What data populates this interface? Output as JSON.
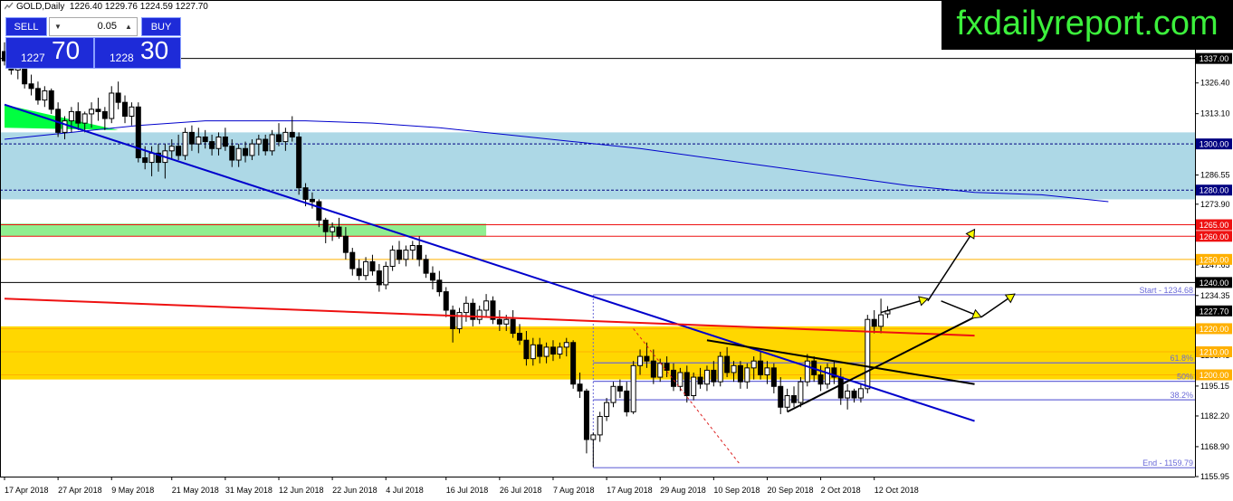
{
  "header": {
    "symbol_label": "GOLD,Daily",
    "ohlc_label": "1226.40 1229.76 1224.59 1227.70"
  },
  "trade_panel": {
    "sell_label": "SELL",
    "buy_label": "BUY",
    "lot_value": "0.05",
    "bid_small": "1227",
    "bid_big": "70",
    "ask_small": "1228",
    "ask_big": "30"
  },
  "brand_text": "fxdailyreport.com",
  "colors": {
    "band_blue": "#add8e6",
    "band_green": "#90ee90",
    "band_gold": "#ffd700",
    "wedge_green": "#00ff40",
    "trend_blue": "#0000cc",
    "trend_red": "#ee1111",
    "fib_line": "#6a6ad8",
    "arrow_fill": "#ffff00"
  },
  "chart_data": {
    "type": "candlestick",
    "y_range": [
      1155.95,
      1340.0
    ],
    "x_index_range": [
      0,
      145
    ],
    "y_tick_labels": [
      "1326.40",
      "1313.10",
      "1286.55",
      "1273.90",
      "1247.65",
      "1234.35",
      "1221.00",
      "1208.45",
      "1195.15",
      "1182.20",
      "1168.90",
      "1155.95"
    ],
    "x_tick_labels": [
      {
        "i": 0,
        "label": "17 Apr 2018"
      },
      {
        "i": 8,
        "label": "27 Apr 2018"
      },
      {
        "i": 16,
        "label": "9 May 2018"
      },
      {
        "i": 25,
        "label": "21 May 2018"
      },
      {
        "i": 33,
        "label": "31 May 2018"
      },
      {
        "i": 41,
        "label": "12 Jun 2018"
      },
      {
        "i": 49,
        "label": "22 Jun 2018"
      },
      {
        "i": 57,
        "label": "4 Jul 2018"
      },
      {
        "i": 66,
        "label": "16 Jul 2018"
      },
      {
        "i": 74,
        "label": "26 Jul 2018"
      },
      {
        "i": 82,
        "label": "7 Aug 2018"
      },
      {
        "i": 90,
        "label": "17 Aug 2018"
      },
      {
        "i": 98,
        "label": "29 Aug 2018"
      },
      {
        "i": 106,
        "label": "10 Sep 2018"
      },
      {
        "i": 114,
        "label": "20 Sep 2018"
      },
      {
        "i": 122,
        "label": "2 Oct 2018"
      },
      {
        "i": 130,
        "label": "12 Oct 2018"
      }
    ],
    "price_labels": [
      {
        "value": 1337.0,
        "text": "1337.00",
        "style": "dark"
      },
      {
        "value": 1300.0,
        "text": "1300.00",
        "style": "navy"
      },
      {
        "value": 1280.0,
        "text": "1280.00",
        "style": "navy"
      },
      {
        "value": 1265.0,
        "text": "1265.00",
        "style": "red"
      },
      {
        "value": 1260.0,
        "text": "1260.00",
        "style": "red"
      },
      {
        "value": 1250.0,
        "text": "1250.00",
        "style": "gold"
      },
      {
        "value": 1240.0,
        "text": "1240.00",
        "style": "dark"
      },
      {
        "value": 1227.7,
        "text": "1227.70",
        "style": "dark"
      },
      {
        "value": 1220.0,
        "text": "1220.00",
        "style": "gold"
      },
      {
        "value": 1210.0,
        "text": "1210.00",
        "style": "gold"
      },
      {
        "value": 1200.0,
        "text": "1200.00",
        "style": "gold"
      }
    ],
    "zones": [
      {
        "name": "resistance-blue",
        "from": 1276,
        "to": 1305,
        "color": "#add8e6"
      },
      {
        "name": "resistance-green",
        "from": 1260,
        "to": 1265.5,
        "color": "#90ee90",
        "x_end_index": 72
      },
      {
        "name": "support-gold",
        "from": 1198,
        "to": 1221,
        "color": "#ffd700"
      }
    ],
    "horizontal_lines": [
      {
        "value": 1337.0,
        "color": "#000000",
        "style": "solid"
      },
      {
        "value": 1300.0,
        "color": "#000080",
        "style": "dashed"
      },
      {
        "value": 1280.0,
        "color": "#000080",
        "style": "dashed"
      },
      {
        "value": 1265.0,
        "color": "#ee1111",
        "style": "solid"
      },
      {
        "value": 1260.0,
        "color": "#ee1111",
        "style": "solid"
      },
      {
        "value": 1250.0,
        "color": "#ffb000",
        "style": "solid"
      },
      {
        "value": 1240.0,
        "color": "#000000",
        "style": "solid"
      },
      {
        "value": 1220.0,
        "color": "#ffb000",
        "style": "solid"
      },
      {
        "value": 1210.0,
        "color": "#ffb000",
        "style": "solid"
      },
      {
        "value": 1200.0,
        "color": "#ffb000",
        "style": "solid"
      }
    ],
    "fibonacci": {
      "start_index": 88,
      "end_index": 145,
      "levels": [
        {
          "value": 1234.68,
          "label": "Start - 1234.68"
        },
        {
          "value": 1205.2,
          "label": "61.8%"
        },
        {
          "value": 1197.2,
          "label": "50%"
        },
        {
          "value": 1189.2,
          "label": "38.2%"
        },
        {
          "value": 1159.79,
          "label": "End - 1159.79"
        }
      ]
    },
    "trendlines": [
      {
        "name": "blue-downtrend",
        "p1": [
          0,
          1317
        ],
        "p2": [
          145,
          1180
        ],
        "color": "#0000cc",
        "width": 2
      },
      {
        "name": "red-trend",
        "p1": [
          0,
          1233
        ],
        "p2": [
          145,
          1217
        ],
        "color": "#ee1111",
        "width": 2
      },
      {
        "name": "wedge-upper",
        "p1": [
          105,
          1215
        ],
        "p2": [
          145,
          1196
        ],
        "color": "#000000",
        "width": 2
      },
      {
        "name": "wedge-lower",
        "p1": [
          117,
          1184
        ],
        "p2": [
          145,
          1225
        ],
        "color": "#000000",
        "width": 2
      },
      {
        "name": "drop-dashed",
        "p1": [
          94,
          1220
        ],
        "p2": [
          110,
          1161
        ],
        "color": "#dd2222",
        "width": 1,
        "dashed": true
      }
    ],
    "moving_average": [
      [
        0,
        1302
      ],
      [
        10,
        1305
      ],
      [
        20,
        1308
      ],
      [
        30,
        1310
      ],
      [
        45,
        1310
      ],
      [
        55,
        1309
      ],
      [
        65,
        1307
      ],
      [
        75,
        1304
      ],
      [
        85,
        1301
      ],
      [
        95,
        1298
      ],
      [
        105,
        1294
      ],
      [
        115,
        1290
      ],
      [
        125,
        1286
      ],
      [
        135,
        1282
      ],
      [
        145,
        1279
      ],
      [
        155,
        1278
      ],
      [
        165,
        1275
      ]
    ],
    "green_wedge": [
      [
        0,
        1317
      ],
      [
        0,
        1307
      ],
      [
        17,
        1306
      ]
    ],
    "projection_arrows": [
      [
        [
          131,
          1227
        ],
        [
          138,
          1233
        ]
      ],
      [
        [
          138,
          1232
        ],
        [
          145,
          1263
        ]
      ],
      [
        [
          140,
          1232
        ],
        [
          146,
          1225
        ]
      ],
      [
        [
          146,
          1225
        ],
        [
          151,
          1235
        ]
      ]
    ],
    "candles": [
      {
        "o": 1340,
        "h": 1344,
        "l": 1334,
        "c": 1336
      },
      {
        "o": 1336,
        "h": 1338,
        "l": 1330,
        "c": 1332
      },
      {
        "o": 1332,
        "h": 1336,
        "l": 1328,
        "c": 1334
      },
      {
        "o": 1334,
        "h": 1335,
        "l": 1324,
        "c": 1326
      },
      {
        "o": 1326,
        "h": 1330,
        "l": 1321,
        "c": 1324
      },
      {
        "o": 1324,
        "h": 1327,
        "l": 1317,
        "c": 1319
      },
      {
        "o": 1319,
        "h": 1325,
        "l": 1316,
        "c": 1323
      },
      {
        "o": 1323,
        "h": 1324,
        "l": 1313,
        "c": 1315
      },
      {
        "o": 1315,
        "h": 1318,
        "l": 1303,
        "c": 1305
      },
      {
        "o": 1305,
        "h": 1312,
        "l": 1302,
        "c": 1310
      },
      {
        "o": 1310,
        "h": 1316,
        "l": 1305,
        "c": 1314
      },
      {
        "o": 1314,
        "h": 1318,
        "l": 1306,
        "c": 1309
      },
      {
        "o": 1309,
        "h": 1314,
        "l": 1305,
        "c": 1313
      },
      {
        "o": 1313,
        "h": 1318,
        "l": 1307,
        "c": 1315
      },
      {
        "o": 1315,
        "h": 1320,
        "l": 1310,
        "c": 1314
      },
      {
        "o": 1314,
        "h": 1316,
        "l": 1306,
        "c": 1311
      },
      {
        "o": 1311,
        "h": 1325,
        "l": 1309,
        "c": 1322
      },
      {
        "o": 1322,
        "h": 1327,
        "l": 1315,
        "c": 1318
      },
      {
        "o": 1318,
        "h": 1321,
        "l": 1309,
        "c": 1312
      },
      {
        "o": 1312,
        "h": 1318,
        "l": 1308,
        "c": 1316
      },
      {
        "o": 1316,
        "h": 1318,
        "l": 1292,
        "c": 1294
      },
      {
        "o": 1294,
        "h": 1299,
        "l": 1289,
        "c": 1292
      },
      {
        "o": 1292,
        "h": 1299,
        "l": 1286,
        "c": 1296
      },
      {
        "o": 1296,
        "h": 1300,
        "l": 1288,
        "c": 1292
      },
      {
        "o": 1292,
        "h": 1300,
        "l": 1285,
        "c": 1297
      },
      {
        "o": 1297,
        "h": 1302,
        "l": 1293,
        "c": 1299
      },
      {
        "o": 1299,
        "h": 1304,
        "l": 1293,
        "c": 1295
      },
      {
        "o": 1295,
        "h": 1307,
        "l": 1293,
        "c": 1305
      },
      {
        "o": 1305,
        "h": 1308,
        "l": 1297,
        "c": 1300
      },
      {
        "o": 1300,
        "h": 1307,
        "l": 1296,
        "c": 1303
      },
      {
        "o": 1303,
        "h": 1306,
        "l": 1298,
        "c": 1301
      },
      {
        "o": 1301,
        "h": 1304,
        "l": 1295,
        "c": 1298
      },
      {
        "o": 1298,
        "h": 1305,
        "l": 1295,
        "c": 1303
      },
      {
        "o": 1303,
        "h": 1307,
        "l": 1297,
        "c": 1299
      },
      {
        "o": 1299,
        "h": 1302,
        "l": 1290,
        "c": 1293
      },
      {
        "o": 1293,
        "h": 1300,
        "l": 1290,
        "c": 1298
      },
      {
        "o": 1298,
        "h": 1301,
        "l": 1292,
        "c": 1295
      },
      {
        "o": 1295,
        "h": 1302,
        "l": 1293,
        "c": 1300
      },
      {
        "o": 1300,
        "h": 1304,
        "l": 1295,
        "c": 1302
      },
      {
        "o": 1302,
        "h": 1304,
        "l": 1295,
        "c": 1297
      },
      {
        "o": 1297,
        "h": 1306,
        "l": 1295,
        "c": 1304
      },
      {
        "o": 1304,
        "h": 1309,
        "l": 1299,
        "c": 1301
      },
      {
        "o": 1301,
        "h": 1307,
        "l": 1297,
        "c": 1305
      },
      {
        "o": 1305,
        "h": 1312,
        "l": 1301,
        "c": 1303
      },
      {
        "o": 1303,
        "h": 1305,
        "l": 1278,
        "c": 1281
      },
      {
        "o": 1281,
        "h": 1283,
        "l": 1273,
        "c": 1276
      },
      {
        "o": 1276,
        "h": 1279,
        "l": 1272,
        "c": 1275
      },
      {
        "o": 1275,
        "h": 1276,
        "l": 1264,
        "c": 1267
      },
      {
        "o": 1267,
        "h": 1268,
        "l": 1257,
        "c": 1262
      },
      {
        "o": 1262,
        "h": 1266,
        "l": 1258,
        "c": 1264
      },
      {
        "o": 1264,
        "h": 1268,
        "l": 1259,
        "c": 1260
      },
      {
        "o": 1260,
        "h": 1264,
        "l": 1250,
        "c": 1253
      },
      {
        "o": 1253,
        "h": 1255,
        "l": 1243,
        "c": 1246
      },
      {
        "o": 1246,
        "h": 1250,
        "l": 1241,
        "c": 1243
      },
      {
        "o": 1243,
        "h": 1251,
        "l": 1241,
        "c": 1249
      },
      {
        "o": 1249,
        "h": 1252,
        "l": 1243,
        "c": 1245
      },
      {
        "o": 1245,
        "h": 1248,
        "l": 1236,
        "c": 1239
      },
      {
        "o": 1239,
        "h": 1249,
        "l": 1237,
        "c": 1247
      },
      {
        "o": 1247,
        "h": 1256,
        "l": 1245,
        "c": 1254
      },
      {
        "o": 1254,
        "h": 1258,
        "l": 1248,
        "c": 1250
      },
      {
        "o": 1250,
        "h": 1256,
        "l": 1247,
        "c": 1254
      },
      {
        "o": 1254,
        "h": 1258,
        "l": 1250,
        "c": 1256
      },
      {
        "o": 1256,
        "h": 1260,
        "l": 1247,
        "c": 1250
      },
      {
        "o": 1250,
        "h": 1252,
        "l": 1242,
        "c": 1244
      },
      {
        "o": 1244,
        "h": 1247,
        "l": 1237,
        "c": 1241
      },
      {
        "o": 1241,
        "h": 1245,
        "l": 1234,
        "c": 1236
      },
      {
        "o": 1236,
        "h": 1238,
        "l": 1225,
        "c": 1228
      },
      {
        "o": 1228,
        "h": 1230,
        "l": 1214,
        "c": 1220
      },
      {
        "o": 1220,
        "h": 1229,
        "l": 1218,
        "c": 1227
      },
      {
        "o": 1227,
        "h": 1234,
        "l": 1223,
        "c": 1231
      },
      {
        "o": 1231,
        "h": 1233,
        "l": 1221,
        "c": 1224
      },
      {
        "o": 1224,
        "h": 1230,
        "l": 1222,
        "c": 1228
      },
      {
        "o": 1228,
        "h": 1235,
        "l": 1225,
        "c": 1232
      },
      {
        "o": 1232,
        "h": 1234,
        "l": 1222,
        "c": 1224
      },
      {
        "o": 1224,
        "h": 1228,
        "l": 1219,
        "c": 1222
      },
      {
        "o": 1222,
        "h": 1226,
        "l": 1219,
        "c": 1224
      },
      {
        "o": 1224,
        "h": 1228,
        "l": 1216,
        "c": 1218
      },
      {
        "o": 1218,
        "h": 1222,
        "l": 1213,
        "c": 1215
      },
      {
        "o": 1215,
        "h": 1219,
        "l": 1204,
        "c": 1207
      },
      {
        "o": 1207,
        "h": 1216,
        "l": 1204,
        "c": 1213
      },
      {
        "o": 1213,
        "h": 1216,
        "l": 1205,
        "c": 1208
      },
      {
        "o": 1208,
        "h": 1214,
        "l": 1205,
        "c": 1212
      },
      {
        "o": 1212,
        "h": 1215,
        "l": 1206,
        "c": 1209
      },
      {
        "o": 1209,
        "h": 1214,
        "l": 1207,
        "c": 1212
      },
      {
        "o": 1212,
        "h": 1216,
        "l": 1208,
        "c": 1214
      },
      {
        "o": 1214,
        "h": 1215,
        "l": 1194,
        "c": 1196
      },
      {
        "o": 1196,
        "h": 1201,
        "l": 1190,
        "c": 1193
      },
      {
        "o": 1193,
        "h": 1194,
        "l": 1166,
        "c": 1172
      },
      {
        "o": 1172,
        "h": 1175,
        "l": 1160,
        "c": 1174
      },
      {
        "o": 1174,
        "h": 1184,
        "l": 1171,
        "c": 1182
      },
      {
        "o": 1182,
        "h": 1190,
        "l": 1180,
        "c": 1188
      },
      {
        "o": 1188,
        "h": 1197,
        "l": 1186,
        "c": 1195
      },
      {
        "o": 1195,
        "h": 1198,
        "l": 1190,
        "c": 1193
      },
      {
        "o": 1193,
        "h": 1197,
        "l": 1182,
        "c": 1184
      },
      {
        "o": 1184,
        "h": 1206,
        "l": 1183,
        "c": 1204
      },
      {
        "o": 1204,
        "h": 1211,
        "l": 1200,
        "c": 1208
      },
      {
        "o": 1208,
        "h": 1214,
        "l": 1203,
        "c": 1206
      },
      {
        "o": 1206,
        "h": 1211,
        "l": 1196,
        "c": 1199
      },
      {
        "o": 1199,
        "h": 1207,
        "l": 1197,
        "c": 1205
      },
      {
        "o": 1205,
        "h": 1208,
        "l": 1199,
        "c": 1202
      },
      {
        "o": 1202,
        "h": 1205,
        "l": 1193,
        "c": 1195
      },
      {
        "o": 1195,
        "h": 1203,
        "l": 1193,
        "c": 1201
      },
      {
        "o": 1201,
        "h": 1204,
        "l": 1188,
        "c": 1191
      },
      {
        "o": 1191,
        "h": 1201,
        "l": 1189,
        "c": 1199
      },
      {
        "o": 1199,
        "h": 1203,
        "l": 1194,
        "c": 1196
      },
      {
        "o": 1196,
        "h": 1204,
        "l": 1193,
        "c": 1202
      },
      {
        "o": 1202,
        "h": 1206,
        "l": 1195,
        "c": 1197
      },
      {
        "o": 1197,
        "h": 1210,
        "l": 1195,
        "c": 1208
      },
      {
        "o": 1208,
        "h": 1212,
        "l": 1199,
        "c": 1201
      },
      {
        "o": 1201,
        "h": 1206,
        "l": 1197,
        "c": 1204
      },
      {
        "o": 1204,
        "h": 1206,
        "l": 1194,
        "c": 1197
      },
      {
        "o": 1197,
        "h": 1205,
        "l": 1194,
        "c": 1203
      },
      {
        "o": 1203,
        "h": 1208,
        "l": 1198,
        "c": 1206
      },
      {
        "o": 1206,
        "h": 1210,
        "l": 1198,
        "c": 1200
      },
      {
        "o": 1200,
        "h": 1206,
        "l": 1196,
        "c": 1203
      },
      {
        "o": 1203,
        "h": 1205,
        "l": 1192,
        "c": 1195
      },
      {
        "o": 1195,
        "h": 1199,
        "l": 1183,
        "c": 1186
      },
      {
        "o": 1186,
        "h": 1194,
        "l": 1184,
        "c": 1191
      },
      {
        "o": 1191,
        "h": 1195,
        "l": 1186,
        "c": 1188
      },
      {
        "o": 1188,
        "h": 1199,
        "l": 1186,
        "c": 1197
      },
      {
        "o": 1197,
        "h": 1209,
        "l": 1195,
        "c": 1206
      },
      {
        "o": 1206,
        "h": 1208,
        "l": 1197,
        "c": 1200
      },
      {
        "o": 1200,
        "h": 1204,
        "l": 1193,
        "c": 1196
      },
      {
        "o": 1196,
        "h": 1205,
        "l": 1194,
        "c": 1203
      },
      {
        "o": 1203,
        "h": 1206,
        "l": 1196,
        "c": 1199
      },
      {
        "o": 1199,
        "h": 1203,
        "l": 1187,
        "c": 1190
      },
      {
        "o": 1190,
        "h": 1196,
        "l": 1185,
        "c": 1193
      },
      {
        "o": 1193,
        "h": 1194,
        "l": 1188,
        "c": 1190
      },
      {
        "o": 1190,
        "h": 1196,
        "l": 1188,
        "c": 1194
      },
      {
        "o": 1194,
        "h": 1226,
        "l": 1192,
        "c": 1224
      },
      {
        "o": 1224,
        "h": 1228,
        "l": 1218,
        "c": 1221
      },
      {
        "o": 1221,
        "h": 1233,
        "l": 1218,
        "c": 1226
      },
      {
        "o": 1226.4,
        "h": 1229.76,
        "l": 1224.59,
        "c": 1227.7
      }
    ]
  }
}
